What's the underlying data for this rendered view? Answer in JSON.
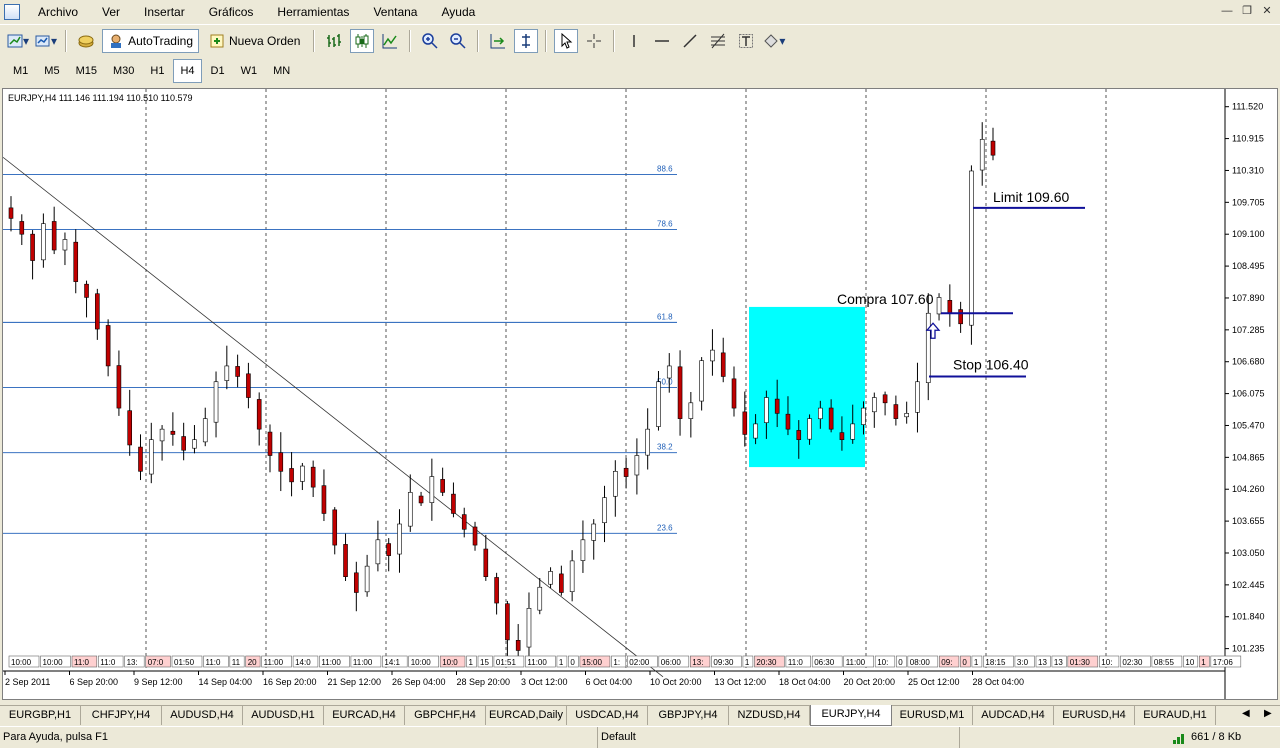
{
  "menu": {
    "items": [
      "Archivo",
      "Ver",
      "Insertar",
      "Gráficos",
      "Herramientas",
      "Ventana",
      "Ayuda"
    ]
  },
  "toolbar": {
    "autotrading_label": "AutoTrading",
    "new_order_label": "Nueva Orden",
    "icons": [
      "new-chart-icon",
      "profiles-icon",
      "market-watch-icon",
      "autotrading-icon",
      "new-order-icon",
      "bar-chart-icon",
      "candlestick-icon",
      "line-chart-icon",
      "zoom-in-icon",
      "zoom-out-icon",
      "autoscroll-icon",
      "chart-shift-icon",
      "cursor-icon",
      "crosshair-icon",
      "vertical-line-icon",
      "horizontal-line-icon",
      "trendline-icon",
      "fibonacci-icon",
      "text-icon",
      "label-icon"
    ]
  },
  "timeframes": {
    "items": [
      "M1",
      "M5",
      "M15",
      "M30",
      "H1",
      "H4",
      "D1",
      "W1",
      "MN"
    ],
    "active": "H4"
  },
  "chart": {
    "header": "EURJPY,H4  111.146 111.194 110.510 110.579",
    "price_labels": [
      "111.520",
      "110.915",
      "110.310",
      "109.705",
      "109.100",
      "108.495",
      "107.890",
      "107.285",
      "106.680",
      "106.075",
      "105.470",
      "104.865",
      "104.260",
      "103.655",
      "103.050",
      "102.445",
      "101.840",
      "101.235"
    ],
    "date_labels": [
      "2 Sep 2011",
      "6 Sep 20:00",
      "9 Sep 12:00",
      "14 Sep 04:00",
      "16 Sep 20:00",
      "21 Sep 12:00",
      "26 Sep 04:00",
      "28 Sep 20:00",
      "3 Oct 12:00",
      "6 Oct 04:00",
      "10 Oct 20:00",
      "13 Oct 12:00",
      "18 Oct 04:00",
      "20 Oct 20:00",
      "25 Oct 12:00",
      "28 Oct 04:00"
    ],
    "fib_levels": [
      "88.6",
      "78.6",
      "61.8",
      "50.0",
      "38.2",
      "23.6"
    ],
    "annotations": {
      "limit": "Limit 109.60",
      "compra": "Compra 107.60",
      "stop": "Stop 106.40"
    },
    "trade_tags": [
      "10:00",
      "10:00",
      "11:0",
      "11:0",
      "13:",
      "07:0",
      "01:50",
      "11:0",
      "11",
      "20",
      "11:00",
      "14:0",
      "11:00",
      "11:00",
      "14:1",
      "10:00",
      "10:0",
      "1",
      "15",
      "01:51",
      "11:00",
      "1",
      "0",
      "15:00",
      "1:",
      "02:00",
      "06:00",
      "13:",
      "09:30",
      "1",
      "20:30",
      "11:0",
      "06:30",
      "11:00",
      "10:",
      "0",
      "08:00",
      "09:",
      "0",
      "1",
      "18:15",
      "3:0",
      "13",
      "13",
      "01:30",
      "10:",
      "02:30",
      "08:55",
      "10",
      "1",
      "17:06"
    ]
  },
  "chart_data": {
    "type": "candlestick",
    "title": "EURJPY,H4",
    "ylim": [
      101.0,
      111.7
    ],
    "ohlc_latest": {
      "open": 111.146,
      "high": 111.194,
      "low": 110.51,
      "close": 110.579
    },
    "trend_sketch_close": [
      109.4,
      109.1,
      108.6,
      109.3,
      108.8,
      109.0,
      108.2,
      107.9,
      107.3,
      106.6,
      105.8,
      105.1,
      104.6,
      105.2,
      105.4,
      105.3,
      105.0,
      105.2,
      105.6,
      106.3,
      106.6,
      106.4,
      106.0,
      105.4,
      104.9,
      104.6,
      104.4,
      104.7,
      104.3,
      103.8,
      103.2,
      102.6,
      102.3,
      102.8,
      103.3,
      103.0,
      103.6,
      104.2,
      104.0,
      104.5,
      104.2,
      103.8,
      103.5,
      103.2,
      102.6,
      102.1,
      101.4,
      101.2,
      102.0,
      102.4,
      102.7,
      102.3,
      102.9,
      103.3,
      103.6,
      104.1,
      104.6,
      104.5,
      104.9,
      105.4,
      106.3,
      106.6,
      105.6,
      105.9,
      106.7,
      106.9,
      106.4,
      105.8,
      105.3,
      105.5,
      106.0,
      105.7,
      105.4,
      105.2,
      105.6,
      105.8,
      105.4,
      105.2,
      105.5,
      105.8,
      106.0,
      105.9,
      105.6,
      105.7,
      106.3,
      107.6,
      107.9,
      107.6,
      107.4,
      110.3,
      110.9,
      110.6
    ],
    "fibonacci": [
      {
        "level": "88.6"
      },
      {
        "level": "78.6"
      },
      {
        "level": "61.8"
      },
      {
        "level": "50.0"
      },
      {
        "level": "38.2"
      },
      {
        "level": "23.6"
      }
    ],
    "trade_levels": {
      "limit": 109.6,
      "entry": 107.6,
      "stop": 106.4
    },
    "highlight_color": "#00ffff",
    "bull_color": "#000000",
    "bear_color": "#c00000",
    "grid": "vertical dashed"
  },
  "symbol_tabs": {
    "items": [
      "EURGBP,H1",
      "CHFJPY,H4",
      "AUDUSD,H4",
      "AUDUSD,H1",
      "EURCAD,H4",
      "GBPCHF,H4",
      "EURCAD,Daily",
      "USDCAD,H4",
      "GBPJPY,H4",
      "NZDUSD,H4",
      "EURJPY,H4",
      "EURUSD,M1",
      "AUDCAD,H4",
      "EURUSD,H4",
      "EURAUD,H1"
    ],
    "active": "EURJPY,H4"
  },
  "status": {
    "help": "Para Ayuda, pulsa F1",
    "profile": "Default",
    "traffic": "661 / 8 Kb"
  }
}
